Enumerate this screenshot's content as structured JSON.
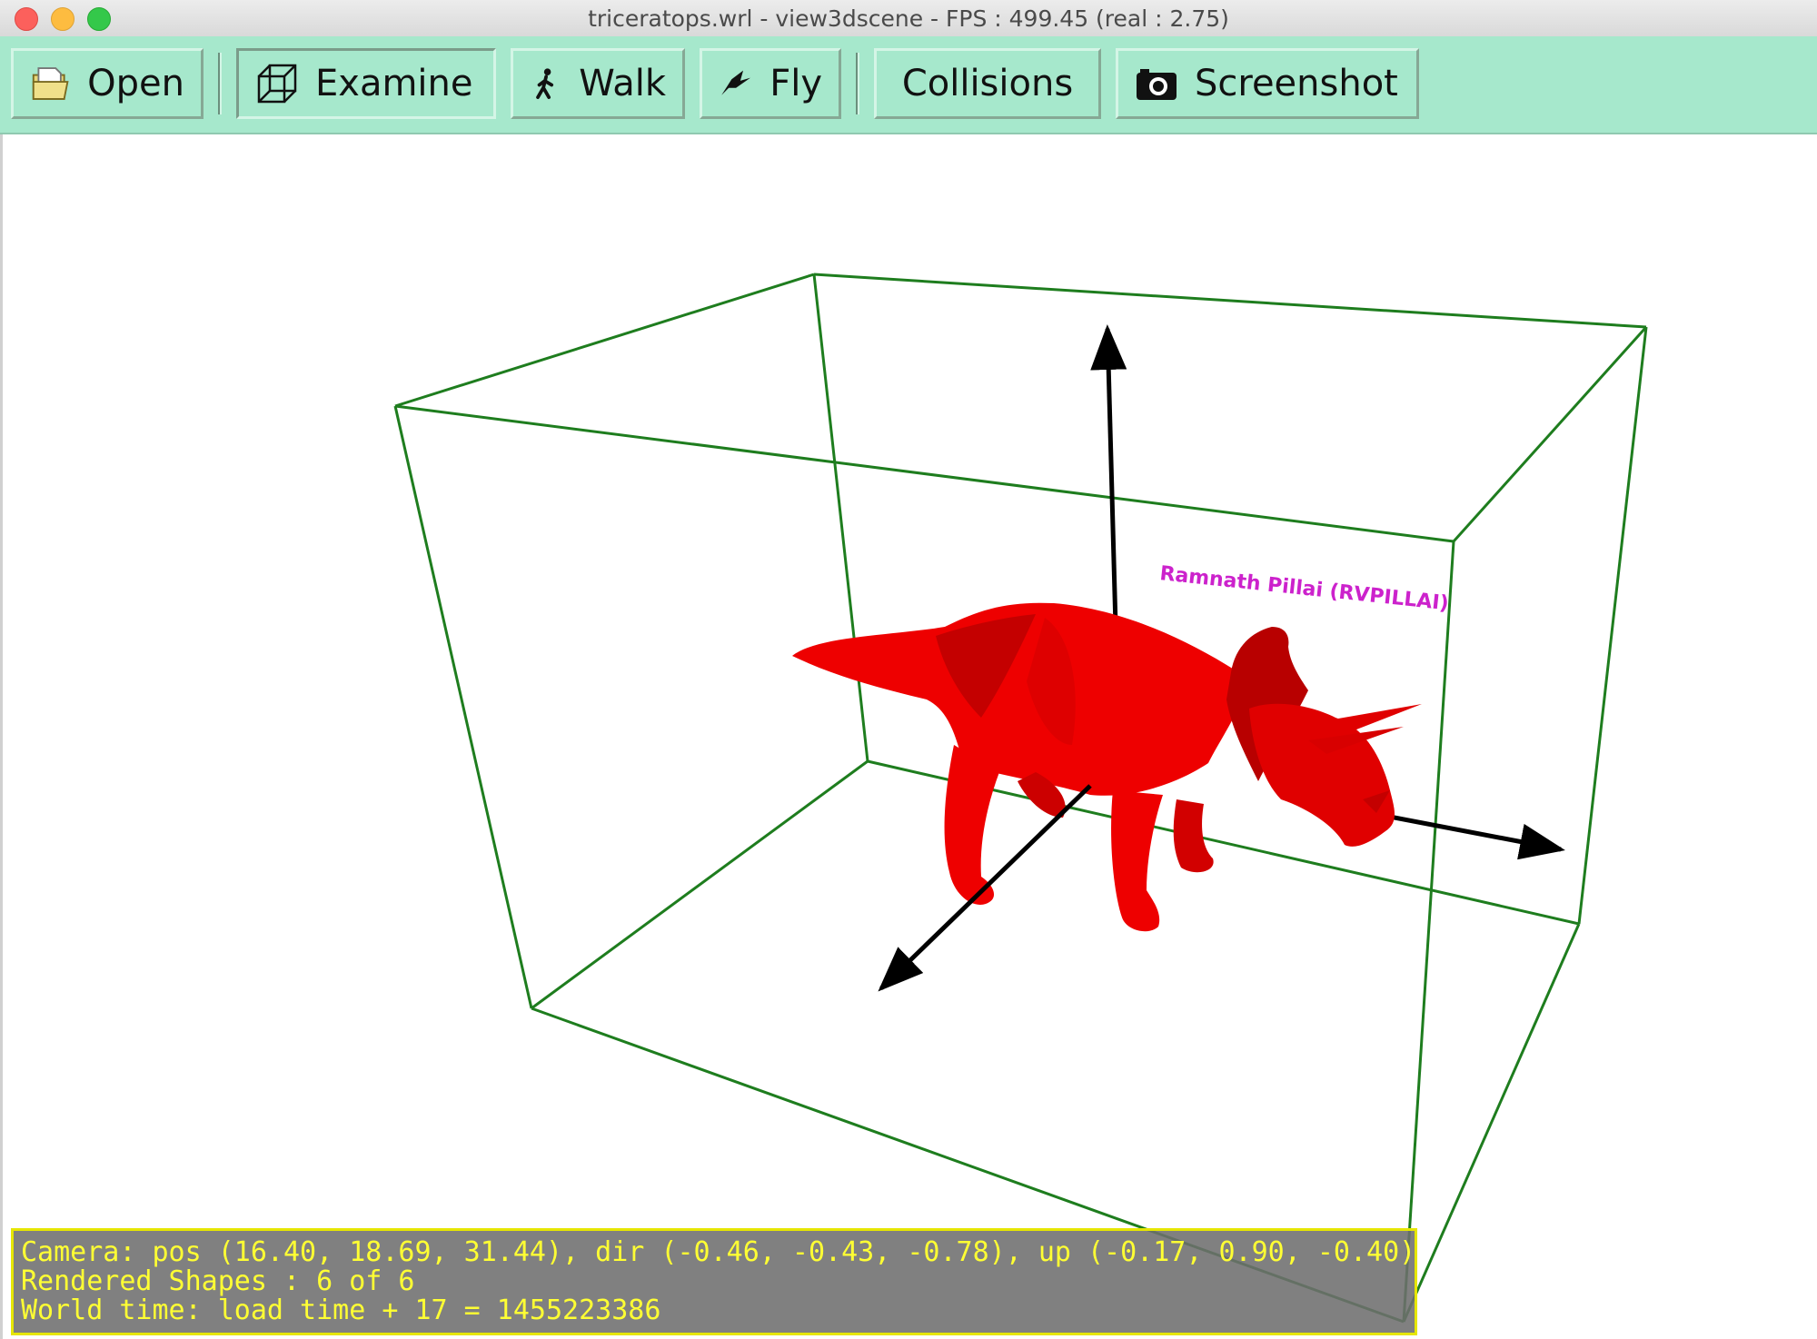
{
  "window": {
    "title": "triceratops.wrl - view3dscene - FPS : 499.45 (real : 2.75)"
  },
  "toolbar": {
    "open_label": "Open",
    "examine_label": "Examine",
    "walk_label": "Walk",
    "fly_label": "Fly",
    "collisions_label": "Collisions",
    "screenshot_label": "Screenshot",
    "active": "Examine"
  },
  "scene": {
    "annotation": "Ramnath Pillai (RVPILLAI)",
    "colors": {
      "bounding_box": "#1e7d1e",
      "model": "#ee0000",
      "axes": "#000000",
      "annotation": "#cc22cc"
    }
  },
  "status": {
    "camera": "Camera: pos (16.40, 18.69, 31.44), dir (-0.46, -0.43, -0.78), up (-0.17, 0.90, -0.40)",
    "shapes": "Rendered Shapes : 6 of 6",
    "world_time": "World time: load time + 17 = 1455223386"
  }
}
